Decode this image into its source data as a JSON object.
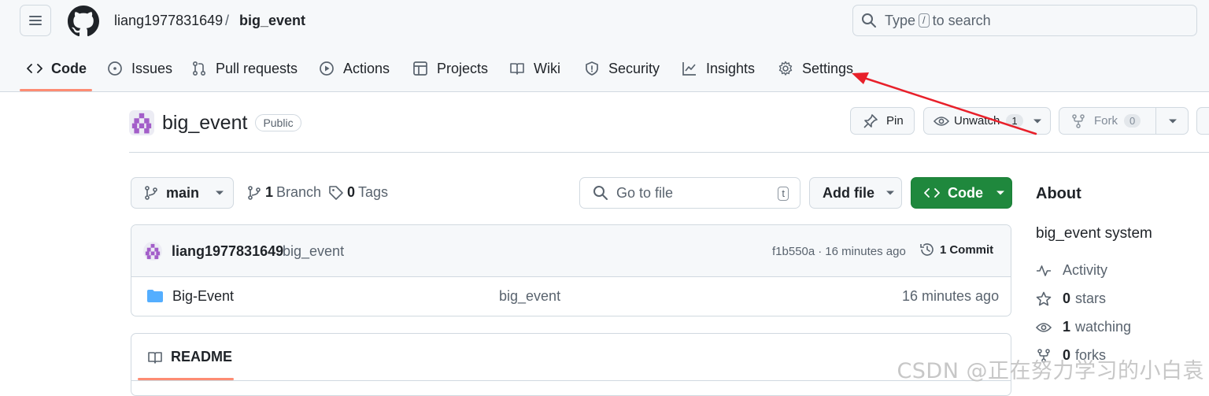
{
  "breadcrumb": {
    "owner": "liang1977831649",
    "separator": "/",
    "repo": "big_event"
  },
  "search": {
    "prefix": "Type",
    "key": "/",
    "suffix": "to search"
  },
  "tabs": [
    {
      "label": "Code",
      "icon": "code-icon"
    },
    {
      "label": "Issues",
      "icon": "issue-icon"
    },
    {
      "label": "Pull requests",
      "icon": "pull-request-icon"
    },
    {
      "label": "Actions",
      "icon": "play-icon"
    },
    {
      "label": "Projects",
      "icon": "table-icon"
    },
    {
      "label": "Wiki",
      "icon": "book-icon"
    },
    {
      "label": "Security",
      "icon": "shield-icon"
    },
    {
      "label": "Insights",
      "icon": "graph-icon"
    },
    {
      "label": "Settings",
      "icon": "gear-icon"
    }
  ],
  "repo": {
    "name": "big_event",
    "visibility": "Public"
  },
  "actions": {
    "pin": "Pin",
    "unwatch": "Unwatch",
    "watch_count": "1",
    "fork": "Fork",
    "fork_count": "0"
  },
  "filenav": {
    "branch": "main",
    "branch_count": "1",
    "branch_label": "Branch",
    "tag_count": "0",
    "tag_label": "Tags",
    "goto_placeholder": "Go to file",
    "goto_key": "t",
    "add_file": "Add file",
    "code": "Code"
  },
  "commit": {
    "author": "liang1977831649",
    "message": "big_event",
    "hash": "f1b550a",
    "sep": "·",
    "time": "16 minutes ago",
    "count": "1",
    "count_label": "Commit"
  },
  "files": [
    {
      "name": "Big-Event",
      "message": "big_event",
      "time": "16 minutes ago"
    }
  ],
  "readme": {
    "label": "README"
  },
  "about": {
    "heading": "About",
    "description": "big_event system",
    "activity": "Activity",
    "stars_count": "0",
    "stars_label": "stars",
    "watching_count": "1",
    "watching_label": "watching",
    "forks_count": "0",
    "forks_label": "forks"
  },
  "watermark": "CSDN @正在努力学习的小白袁",
  "colors": {
    "accent_underline": "#fd8c73",
    "green_button": "#1f883d",
    "annotation_arrow": "#e8202a",
    "folder": "#54aeff"
  }
}
